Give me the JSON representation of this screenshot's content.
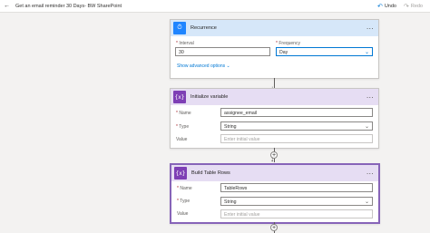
{
  "topbar": {
    "back_icon": "arrow-left-icon",
    "title": "Get an email reminder 30 Days- BW SharePoint",
    "undo_label": "Undo",
    "redo_label": "Redo"
  },
  "recurrence": {
    "title": "Recurrence",
    "icon": "clock-icon",
    "interval_label": "Interval",
    "interval_value": "30",
    "frequency_label": "Frequency",
    "frequency_value": "Day",
    "advanced_link": "Show advanced options"
  },
  "init_var": {
    "title": "Initialize variable",
    "icon": "variable-icon",
    "name_label": "Name",
    "name_value": "assignee_email",
    "type_label": "Type",
    "type_value": "String",
    "value_label": "Value",
    "value_placeholder": "Enter initial value"
  },
  "build_rows": {
    "title": "Build Table Rows",
    "icon": "variable-icon",
    "name_label": "Name",
    "name_value": "TableRows",
    "type_label": "Type",
    "type_value": "String",
    "value_label": "Value",
    "value_placeholder": "Enter initial value"
  },
  "colors": {
    "accent": "#0078d4",
    "recurrence_icon": "#1f85ff",
    "variable_icon": "#7e3fb5",
    "selected_border": "#8764b8"
  }
}
